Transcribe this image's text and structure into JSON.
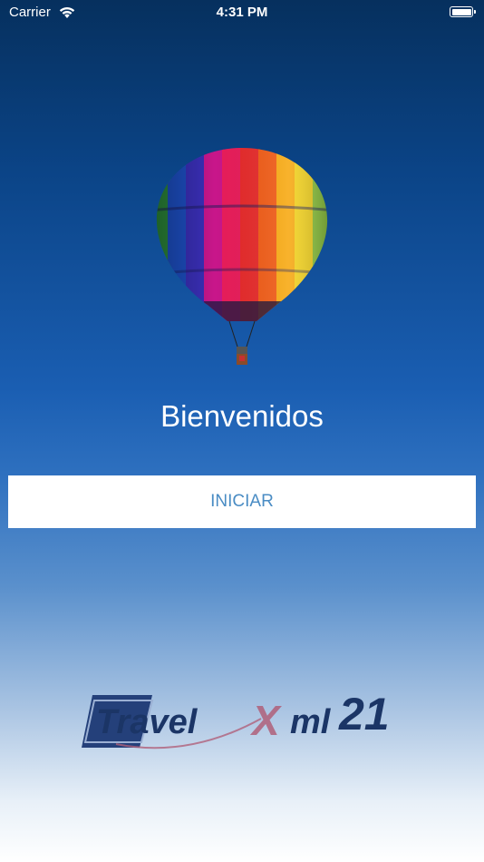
{
  "status_bar": {
    "carrier": "Carrier",
    "time": "4:31 PM"
  },
  "welcome": {
    "title": "Bienvenidos"
  },
  "actions": {
    "start_label": "INICIAR"
  },
  "brand": {
    "logo_text_travel": "Travel",
    "logo_text_x": "X",
    "logo_text_ml": "ml",
    "logo_text_number": "21"
  },
  "colors": {
    "accent": "#4a8cc4",
    "logo_navy": "#1b3566",
    "logo_x": "#b0607a"
  }
}
